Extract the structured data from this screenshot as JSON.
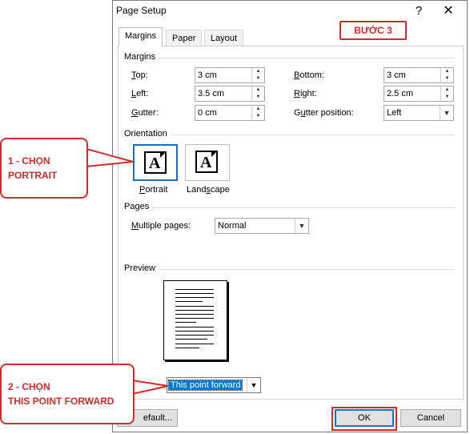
{
  "dialog": {
    "title": "Page Setup",
    "help_glyph": "?",
    "close_glyph": "✕",
    "tabs": [
      {
        "label": "Margins"
      },
      {
        "label": "Paper"
      },
      {
        "label": "Layout"
      }
    ],
    "active_tab": "Margins"
  },
  "margins": {
    "group_title": "Margins",
    "top": {
      "label_u": "T",
      "label_rest": "op:",
      "value": "3 cm"
    },
    "bottom": {
      "label_u": "B",
      "label_rest": "ottom:",
      "value": "3 cm"
    },
    "left": {
      "label_u": "L",
      "label_rest": "eft:",
      "value": "3.5 cm"
    },
    "right": {
      "label_u": "R",
      "label_rest": "ight:",
      "value": "2.5 cm"
    },
    "gutter": {
      "label_u": "G",
      "label_rest": "utter:",
      "value": "0 cm"
    },
    "gutter_position": {
      "label_pre": "G",
      "label_u": "u",
      "label_rest": "tter position:",
      "value": "Left"
    }
  },
  "orientation": {
    "group_title": "Orientation",
    "portrait": {
      "glyph": "A",
      "label_u": "P",
      "label_rest": "ortrait"
    },
    "landscape": {
      "glyph": "A",
      "label_pre": "Land",
      "label_u": "s",
      "label_rest": "cape"
    },
    "selected": "portrait"
  },
  "pages": {
    "group_title": "Pages",
    "multiple_pages": {
      "label_u": "M",
      "label_rest": "ultiple pages:",
      "value": "Normal"
    }
  },
  "preview": {
    "group_title": "Preview"
  },
  "apply_to": {
    "value": "This point forward"
  },
  "buttons": {
    "default_label": "efault...",
    "ok": "OK",
    "cancel": "Cancel"
  },
  "annotations": {
    "step_badge": "BƯỚC 3",
    "callout_1_line1": "1 - CHỌN",
    "callout_1_line2": "PORTRAIT",
    "callout_2_line1": "2 - CHỌN",
    "callout_2_line2": "THIS POINT FORWARD",
    "color": "#d42a2a"
  },
  "colors": {
    "accent": "#0078d7",
    "selection_border": "#1e6fc4"
  }
}
